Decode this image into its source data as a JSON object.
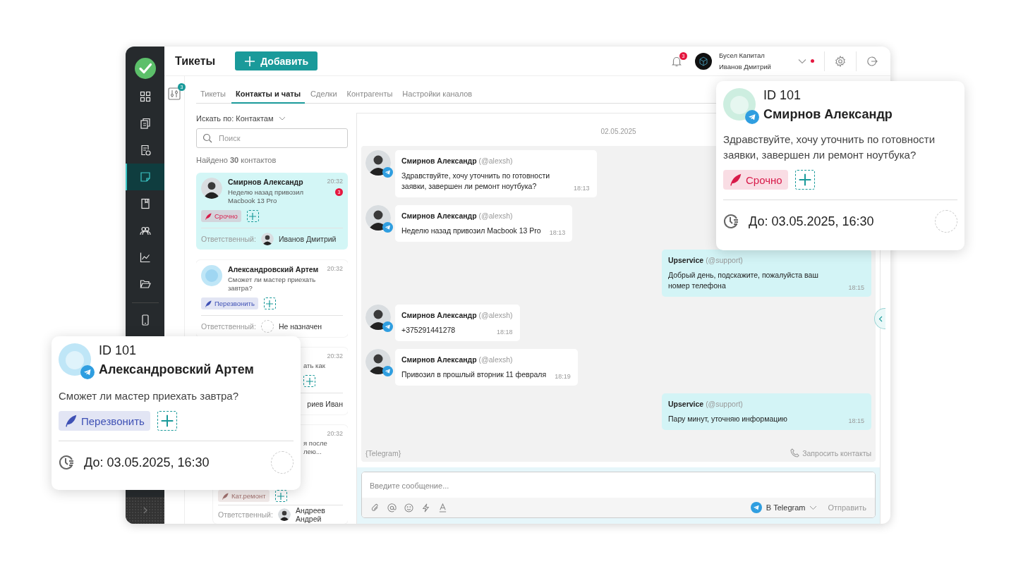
{
  "sidebar": {
    "items": [
      {
        "selected": false
      },
      {
        "selected": false
      },
      {
        "selected": false
      },
      {
        "selected": true
      },
      {
        "selected": false
      },
      {
        "selected": false
      },
      {
        "selected": false
      },
      {
        "selected": false
      },
      {
        "selected": false
      }
    ]
  },
  "header": {
    "title": "Тикеты",
    "add_button": "Добавить",
    "notifications": "3",
    "company": "Бусел Капитал",
    "user": "Иванов Дмитрий",
    "online": true
  },
  "filter_count": "3",
  "tabs": [
    {
      "label": "Тикеты",
      "selected": false
    },
    {
      "label": "Контакты и чаты",
      "selected": true
    },
    {
      "label": "Сделки",
      "selected": false
    },
    {
      "label": "Контрагенты",
      "selected": false
    },
    {
      "label": "Настройки каналов",
      "selected": false
    }
  ],
  "contacts": {
    "search_by": "Искать по: Контактам",
    "search_placeholder": "Поиск",
    "found": "Найдено **30** контактов",
    "items": [
      {
        "kind": "full",
        "selected": true,
        "photo": true,
        "name": "Смирнов Александр",
        "preview": "Неделю назад привозил Macbook 13 Pro",
        "time": "20:32",
        "unread": "3",
        "tag": {
          "label": "Срочно",
          "color": "#d81b4a"
        },
        "responsible_label": "Ответственный:",
        "responsible": "Иванов Дмитрий",
        "assigned": true
      },
      {
        "kind": "full",
        "selected": false,
        "photo": false,
        "name": "Александровский Артем",
        "preview": "Сможет ли мастер приехать завтра?",
        "time": "20:32",
        "tag": {
          "label": "Перезвонить",
          "color": "#3f51b5"
        },
        "responsible_label": "Ответственный:",
        "responsible": "Не назначен",
        "assigned": false
      },
      {
        "kind": "covered",
        "selected": false,
        "preview": "ать как",
        "time": "20:32",
        "responsible": "риев Иван"
      },
      {
        "kind": "covered",
        "selected": false,
        "preview": "я после\nлею...",
        "time": "20:32",
        "tag": {
          "label": "Кат.ремонт",
          "color": "#a0706e"
        },
        "responsible_label": "Ответственный:",
        "responsible": "Андреев Андрей",
        "assigned": true
      }
    ]
  },
  "chat": {
    "date": "02.05.2025",
    "messages": [
      {
        "kind": "incoming",
        "name": "Смирнов Александр",
        "handle": "(@alexsh)",
        "text": "Здравствуйте, хочу уточнить по готовности заявки, завершен ли ремонт ноутбука?",
        "time": "18:13"
      },
      {
        "kind": "incoming",
        "name": "Смирнов Александр",
        "handle": "(@alexsh)",
        "text": "Неделю назад привозил Macbook 13 Pro",
        "time": "18:13"
      },
      {
        "kind": "outgoing",
        "name": "Upservice",
        "handle": "(@support)",
        "text": "Добрый день, подскажите, пожалуйста ваш номер телефона",
        "time": "18:15"
      },
      {
        "kind": "incoming",
        "name": "Смирнов Александр",
        "handle": "(@alexsh)",
        "text": "+375291441278",
        "time": "18:18"
      },
      {
        "kind": "incoming",
        "name": "Смирнов Александр",
        "handle": "(@alexsh)",
        "text": "Привозил в прошлый вторник 11 февраля",
        "time": "18:19"
      },
      {
        "kind": "outgoing",
        "name": "Upservice",
        "handle": "(@support)",
        "text": "Пару минут, уточняю информацию",
        "time": "18:15"
      }
    ],
    "channel": "{Telegram}",
    "request_contacts": "Запросить контакты",
    "composer": {
      "placeholder": "Введите сообщение...",
      "channel": "В Telegram",
      "send": "Отправить"
    }
  },
  "popups": [
    {
      "id": "ID 101",
      "name": "Смирнов Александр",
      "message": "Здравствуйте, хочу уточнить по готовности заявки, завершен ли ремонт ноутбука?",
      "tag": {
        "label": "Срочно",
        "color": "#d81b4a"
      },
      "due": "До: 03.05.2025, 16:30"
    },
    {
      "id": "ID 101",
      "name": "Александровский Артем",
      "message": "Сможет ли мастер приехать завтра?",
      "tag": {
        "label": "Перезвонить",
        "color": "#3f51b5"
      },
      "due": "До: 03.05.2025, 16:30"
    }
  ]
}
